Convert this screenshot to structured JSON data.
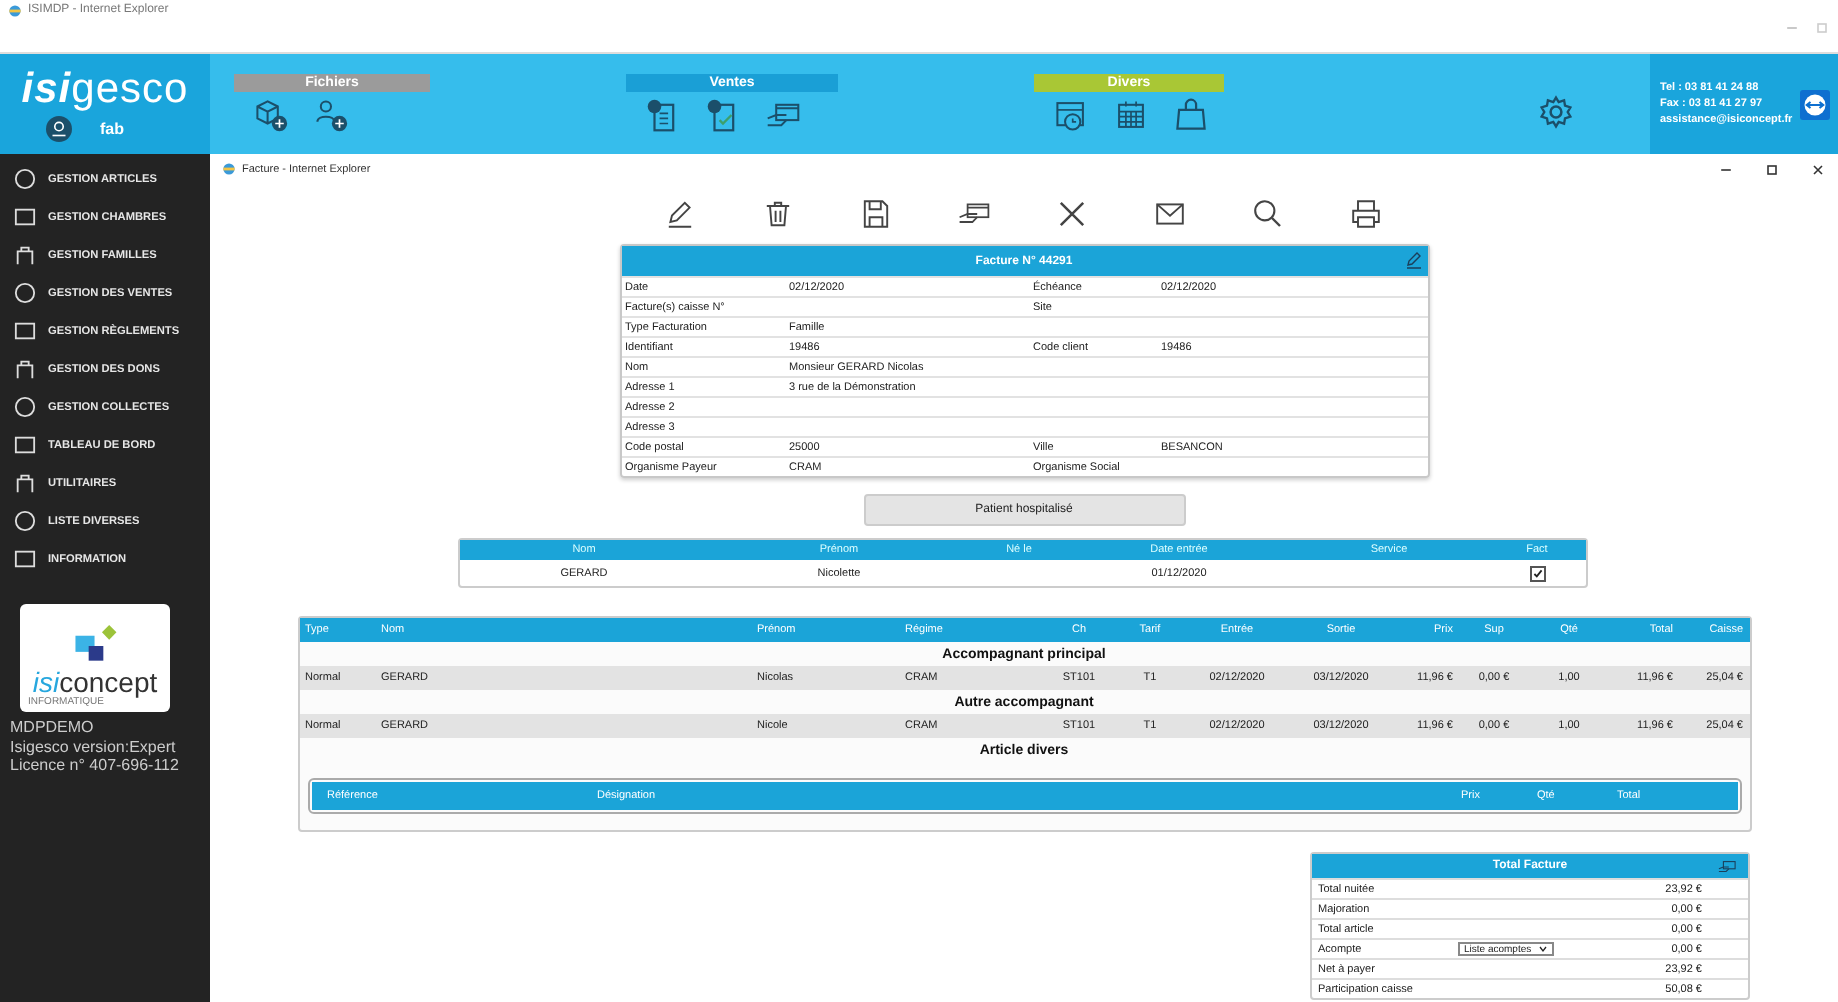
{
  "browser": {
    "title": "ISIMDP - Internet Explorer"
  },
  "header": {
    "logo_a": "isi",
    "logo_b": "gesco",
    "user": "fab",
    "groups": [
      {
        "label": "Fichiers",
        "color": "#9b9b9b"
      },
      {
        "label": "Ventes",
        "color": "#1a9fd6"
      },
      {
        "label": "Divers",
        "color": "#a9c735"
      }
    ],
    "contact": [
      "Tel : 03 81 41 24 88",
      "Fax : 03 81 41 27 97",
      "assistance@isiconcept.fr"
    ]
  },
  "sidebar": {
    "items": [
      {
        "label": "GESTION ARTICLES"
      },
      {
        "label": "GESTION CHAMBRES"
      },
      {
        "label": "GESTION FAMILLES"
      },
      {
        "label": "GESTION DES VENTES"
      },
      {
        "label": "GESTION RÈGLEMENTS"
      },
      {
        "label": "GESTION DES DONS"
      },
      {
        "label": "GESTION COLLECTES"
      },
      {
        "label": "TABLEAU DE BORD"
      },
      {
        "label": "UTILITAIRES"
      },
      {
        "label": "LISTE DIVERSES"
      },
      {
        "label": "INFORMATION"
      }
    ],
    "company": {
      "logo_a": "isi",
      "logo_b": "concept",
      "tagline": "INFORMATIQUE"
    },
    "info": [
      "MDPDEMO",
      "Isigesco version:Expert",
      "Licence n° 407-696-112"
    ]
  },
  "popup": {
    "title": "Facture - Internet Explorer"
  },
  "invoice": {
    "title": "Facture N° 44291",
    "rows": [
      [
        "Date",
        "02/12/2020",
        "Échéance",
        "02/12/2020"
      ],
      [
        "Facture(s) caisse N°",
        "",
        "Site",
        ""
      ],
      [
        "Type Facturation",
        "Famille",
        "",
        ""
      ],
      [
        "Identifiant",
        "19486",
        "Code client",
        "19486"
      ],
      [
        "Nom",
        "Monsieur GERARD Nicolas",
        "",
        ""
      ],
      [
        "Adresse 1",
        "3 rue de la Démonstration",
        "",
        ""
      ],
      [
        "Adresse 2",
        "",
        "",
        ""
      ],
      [
        "Adresse 3",
        "",
        "",
        ""
      ],
      [
        "Code postal",
        "25000",
        "Ville",
        "BESANCON"
      ],
      [
        "Organisme Payeur",
        "CRAM",
        "Organisme Social",
        ""
      ]
    ]
  },
  "patient_button": "Patient hospitalisé",
  "patients": {
    "columns": [
      "Nom",
      "Prénom",
      "Né le",
      "Date entrée",
      "Service",
      "Fact"
    ],
    "rows": [
      {
        "cells": [
          "GERARD",
          "Nicolette",
          "",
          "01/12/2020",
          ""
        ],
        "fact": true
      }
    ]
  },
  "lines": {
    "columns": [
      "Type",
      "Nom",
      "Prénom",
      "Régime",
      "Ch",
      "Tarif",
      "Entrée",
      "Sortie",
      "Prix",
      "Sup",
      "Qté",
      "Total",
      "Caisse"
    ],
    "items": [
      {
        "kind": "heading",
        "title": "Accompagnant principal"
      },
      {
        "kind": "row",
        "cells": [
          "Normal",
          "GERARD",
          "Nicolas",
          "CRAM",
          "ST101",
          "T1",
          "02/12/2020",
          "03/12/2020",
          "11,96 €",
          "0,00 €",
          "1,00",
          "11,96 €",
          "25,04 €"
        ]
      },
      {
        "kind": "heading",
        "title": "Autre accompagnant"
      },
      {
        "kind": "row",
        "cells": [
          "Normal",
          "GERARD",
          "Nicole",
          "CRAM",
          "ST101",
          "T1",
          "02/12/2020",
          "03/12/2020",
          "11,96 €",
          "0,00 €",
          "1,00",
          "11,96 €",
          "25,04 €"
        ]
      },
      {
        "kind": "heading",
        "title": "Article divers"
      }
    ],
    "articles_columns": [
      "Référence",
      "Désignation",
      "Prix",
      "Qté",
      "Total"
    ]
  },
  "totals": {
    "title": "Total Facture",
    "rows": [
      {
        "label": "Total nuitée",
        "value": "23,92 €"
      },
      {
        "label": "Majoration",
        "value": "0,00 €"
      },
      {
        "label": "Total article",
        "value": "0,00 €"
      },
      {
        "label": "Acompte",
        "select": "Liste acomptes",
        "value": "0,00 €"
      },
      {
        "label": "Net à payer",
        "value": "23,92 €"
      },
      {
        "label": "Participation caisse",
        "value": "50,08 €"
      }
    ]
  }
}
